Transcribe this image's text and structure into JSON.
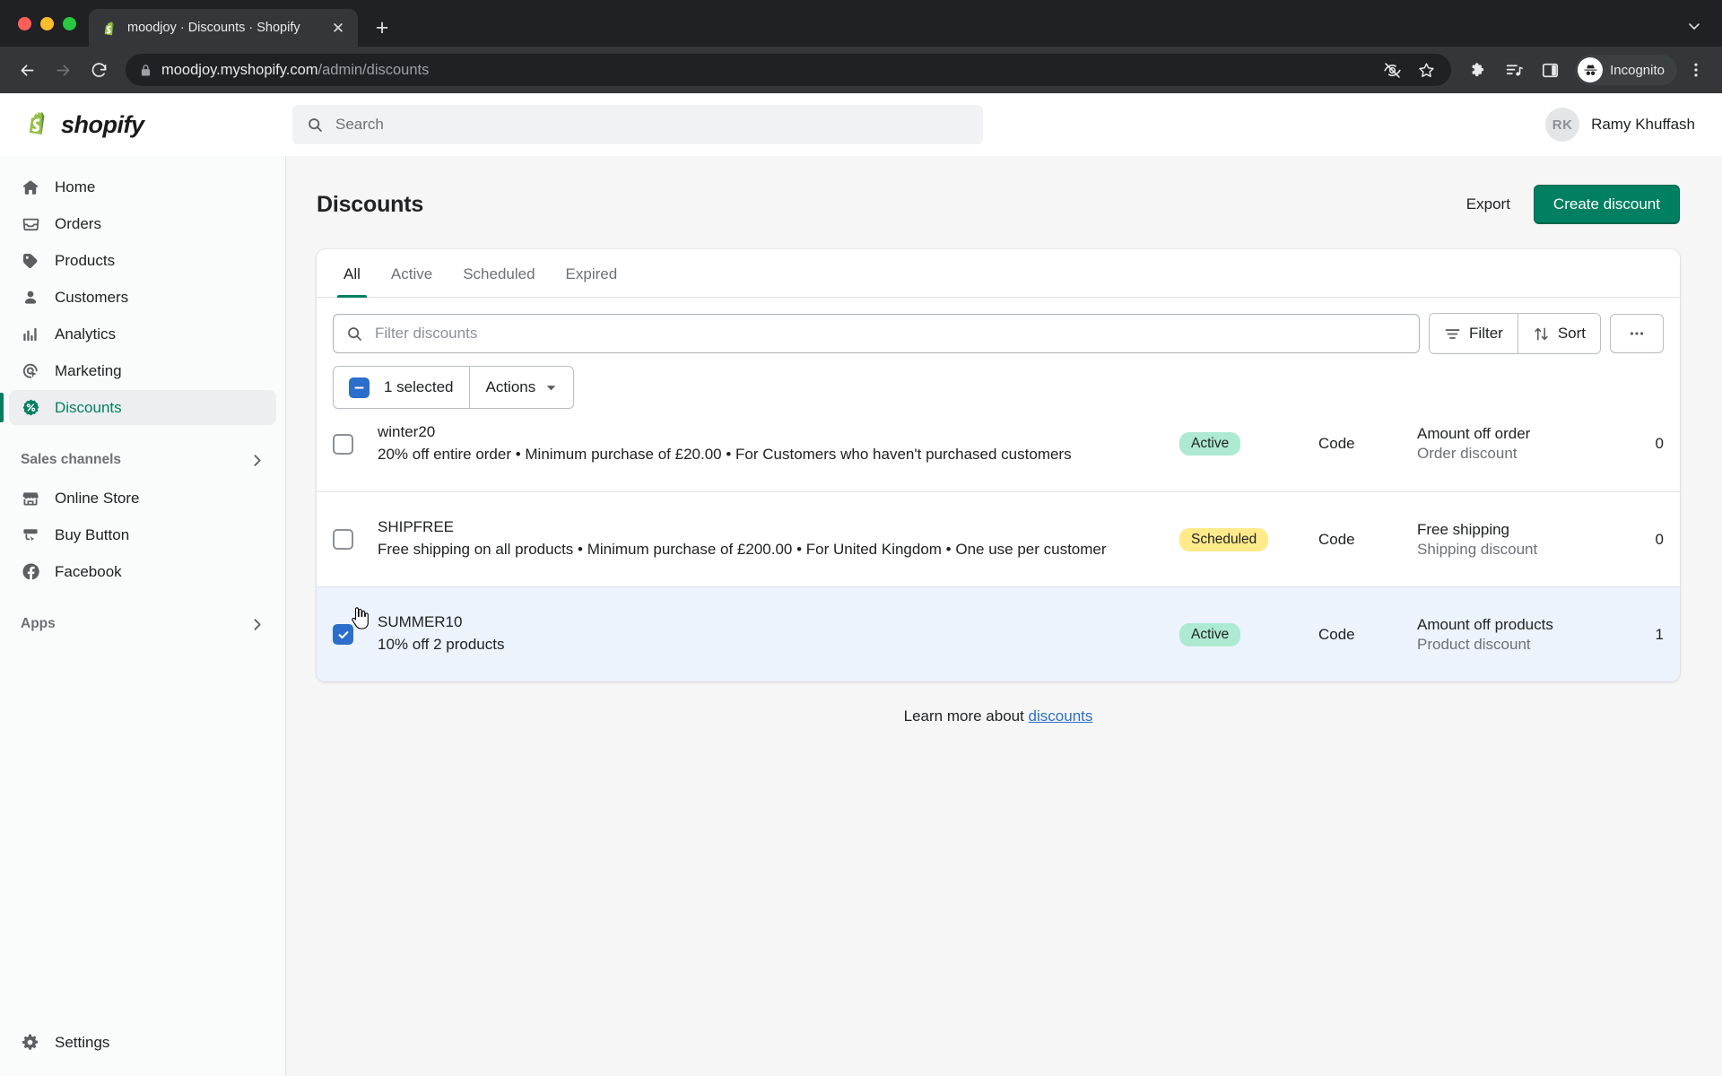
{
  "browser": {
    "tab": {
      "title": "moodjoy · Discounts · Shopify",
      "favicon": "shopify-bag-icon",
      "close_label": "✕"
    },
    "new_tab_label": "+",
    "nav": {
      "back": "back-arrow-icon",
      "forward": "forward-arrow-icon",
      "reload": "reload-icon"
    },
    "omnibox": {
      "lock": "lock-icon",
      "url_host": "moodjoy.myshopify.com",
      "url_path": "/admin/discounts",
      "full_url": "moodjoy.myshopify.com/admin/discounts"
    },
    "toolbar_icons": [
      "eye-off-icon",
      "star-icon",
      "extensions-puzzle-icon",
      "reading-list-icon",
      "side-panel-icon"
    ],
    "profile": {
      "label": "Incognito",
      "icon": "incognito-hat-icon"
    },
    "menu": "three-dot-menu-icon"
  },
  "topbar": {
    "brand": "shopify",
    "search": {
      "placeholder": "Search",
      "icon": "search-icon"
    },
    "user": {
      "initials": "RK",
      "name": "Ramy Khuffash"
    }
  },
  "sidebar": {
    "items": [
      {
        "label": "Home",
        "icon": "home-icon",
        "active": false
      },
      {
        "label": "Orders",
        "icon": "orders-inbox-icon",
        "active": false
      },
      {
        "label": "Products",
        "icon": "products-tag-icon",
        "active": false
      },
      {
        "label": "Customers",
        "icon": "customers-person-icon",
        "active": false
      },
      {
        "label": "Analytics",
        "icon": "analytics-bars-icon",
        "active": false
      },
      {
        "label": "Marketing",
        "icon": "marketing-target-icon",
        "active": false
      },
      {
        "label": "Discounts",
        "icon": "discounts-percent-icon",
        "active": true
      }
    ],
    "sections": [
      {
        "label": "Sales channels",
        "chevron": "chevron-right-icon",
        "items": [
          {
            "label": "Online Store",
            "icon": "online-store-icon"
          },
          {
            "label": "Buy Button",
            "icon": "buy-button-icon"
          },
          {
            "label": "Facebook",
            "icon": "facebook-icon"
          }
        ]
      },
      {
        "label": "Apps",
        "chevron": "chevron-right-icon",
        "items": []
      }
    ],
    "settings": {
      "label": "Settings",
      "icon": "gear-icon"
    }
  },
  "page": {
    "title": "Discounts",
    "export_label": "Export",
    "create_label": "Create discount"
  },
  "tabs": [
    {
      "label": "All",
      "selected": true
    },
    {
      "label": "Active",
      "selected": false
    },
    {
      "label": "Scheduled",
      "selected": false
    },
    {
      "label": "Expired",
      "selected": false
    }
  ],
  "filter": {
    "placeholder": "Filter discounts",
    "search_icon": "search-icon",
    "filter_label": "Filter",
    "filter_icon": "filter-lines-icon",
    "sort_label": "Sort",
    "sort_icon": "sort-arrows-icon",
    "more_icon": "horizontal-dots-icon"
  },
  "bulk": {
    "checkbox_state": "indeterminate",
    "count_label": "1 selected",
    "actions_label": "Actions",
    "actions_caret": "caret-down-icon"
  },
  "table": {
    "rows": [
      {
        "code": "winter20",
        "description": "20% off entire order • Minimum purchase of £20.00 • For Customers who haven't purchased customers",
        "status": "Active",
        "status_kind": "active",
        "method": "Code",
        "type": "Amount off order",
        "type_sub": "Order discount",
        "used": "0",
        "selected": false
      },
      {
        "code": "SHIPFREE",
        "description": "Free shipping on all products • Minimum purchase of £200.00 • For United Kingdom • One use per customer",
        "status": "Scheduled",
        "status_kind": "scheduled",
        "method": "Code",
        "type": "Free shipping",
        "type_sub": "Shipping discount",
        "used": "0",
        "selected": false
      },
      {
        "code": "SUMMER10",
        "description": "10% off 2 products",
        "status": "Active",
        "status_kind": "active",
        "method": "Code",
        "type": "Amount off products",
        "type_sub": "Product discount",
        "used": "1",
        "selected": true
      }
    ]
  },
  "footer": {
    "text": "Learn more about ",
    "link": "discounts"
  },
  "colors": {
    "brand_green": "#008060",
    "badge_active": "#aee9d1",
    "badge_scheduled": "#ffea8a",
    "selected_row": "#edf3fd",
    "checkbox_blue": "#2c6ecb",
    "link_blue": "#2c6ecb"
  }
}
